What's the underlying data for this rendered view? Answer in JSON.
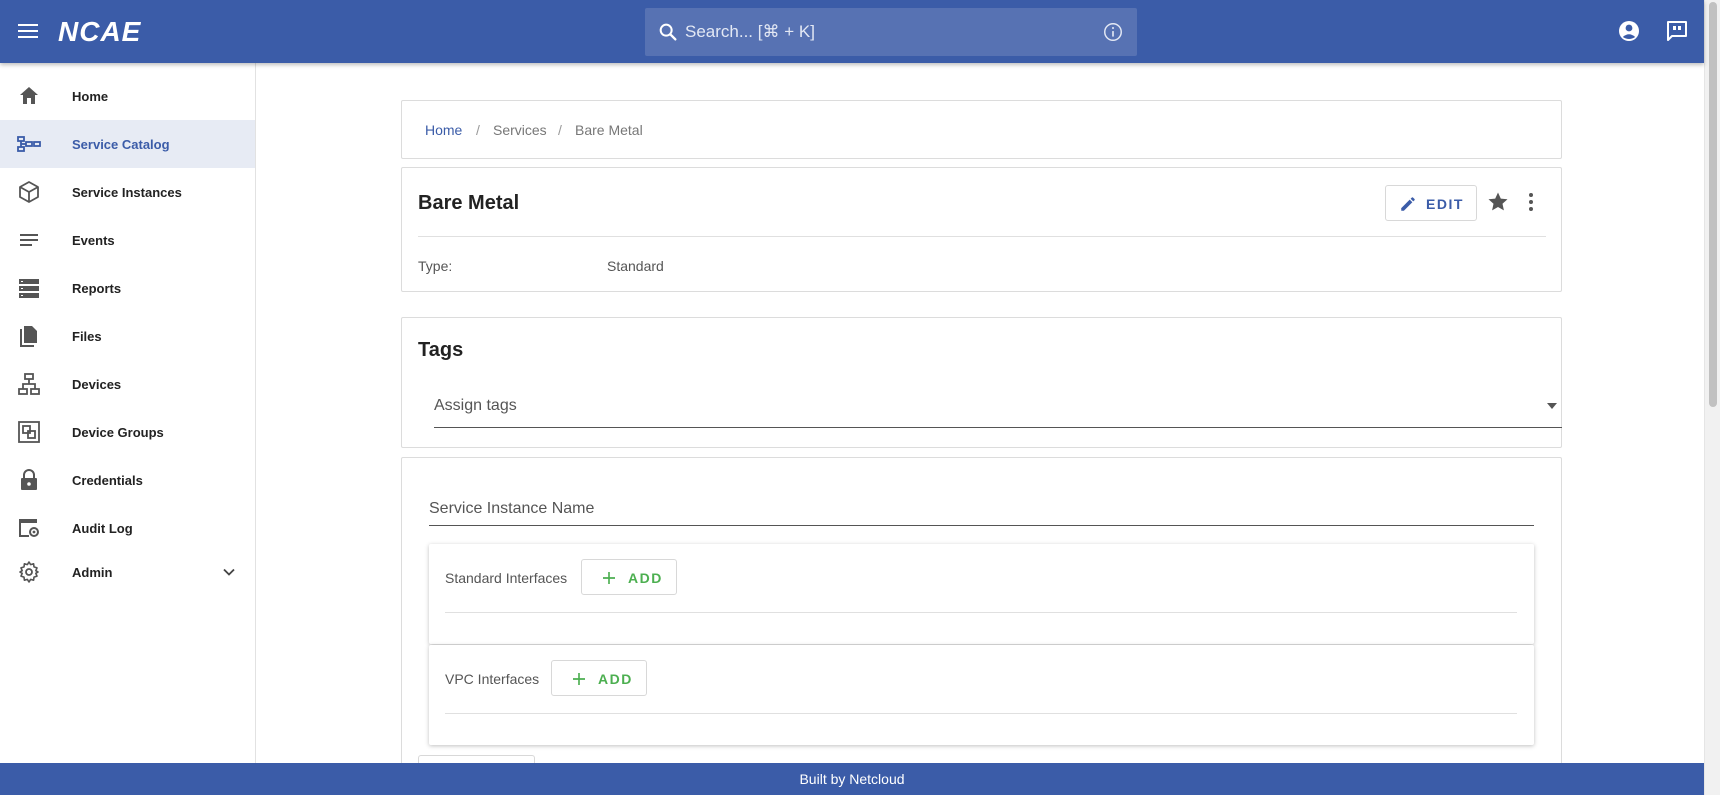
{
  "app": {
    "logo": "NCAE",
    "search_placeholder": "Search... [⌘ + K]",
    "footer": "Built by Netcloud"
  },
  "sidebar": {
    "items": [
      {
        "label": "Home",
        "icon": "home-icon"
      },
      {
        "label": "Service Catalog",
        "icon": "service-catalog-icon",
        "active": true
      },
      {
        "label": "Service Instances",
        "icon": "cube-icon"
      },
      {
        "label": "Events",
        "icon": "list-icon"
      },
      {
        "label": "Reports",
        "icon": "reports-icon"
      },
      {
        "label": "Files",
        "icon": "files-icon"
      },
      {
        "label": "Devices",
        "icon": "network-icon"
      },
      {
        "label": "Device Groups",
        "icon": "device-groups-icon"
      },
      {
        "label": "Credentials",
        "icon": "lock-icon"
      },
      {
        "label": "Audit Log",
        "icon": "audit-log-icon"
      },
      {
        "label": "Admin",
        "icon": "gear-icon",
        "expandable": true
      }
    ]
  },
  "breadcrumb": {
    "items": [
      "Home",
      "Services",
      "Bare Metal"
    ],
    "separator": "/"
  },
  "detail": {
    "title": "Bare Metal",
    "edit_label": "EDIT",
    "type_label": "Type:",
    "type_value": "Standard"
  },
  "tags": {
    "title": "Tags",
    "placeholder": "Assign tags"
  },
  "form": {
    "name_placeholder": "Service Instance Name",
    "standard_interfaces_label": "Standard Interfaces",
    "vpc_interfaces_label": "VPC Interfaces",
    "add_label": "ADD"
  },
  "colors": {
    "primary": "#3b5ca8",
    "add_green": "#4caf50",
    "active_nav_bg": "#e7ebf4"
  }
}
